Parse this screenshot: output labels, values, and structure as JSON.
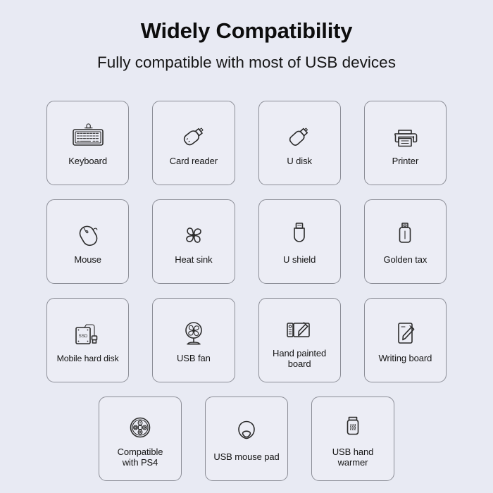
{
  "header": {
    "title": "Widely Compatibility",
    "subtitle": "Fully compatible with most of USB devices"
  },
  "colors": {
    "background": "#e8eaf3",
    "card_background": "#ecedf5",
    "card_border": "#8b8d96",
    "icon_stroke": "#2b2b2b",
    "text": "#151515"
  },
  "grid": {
    "rows": [
      {
        "cards": [
          {
            "label": "Keyboard",
            "icon": "keyboard-icon"
          },
          {
            "label": "Card reader",
            "icon": "card-reader-icon"
          },
          {
            "label": "U disk",
            "icon": "u-disk-icon"
          },
          {
            "label": "Printer",
            "icon": "printer-icon"
          }
        ]
      },
      {
        "cards": [
          {
            "label": "Mouse",
            "icon": "mouse-icon"
          },
          {
            "label": "Heat sink",
            "icon": "heat-sink-fan-icon"
          },
          {
            "label": "U shield",
            "icon": "u-shield-icon"
          },
          {
            "label": "Golden tax",
            "icon": "golden-tax-usb-icon"
          }
        ]
      },
      {
        "cards": [
          {
            "label": "Mobile hard disk",
            "icon": "mobile-hard-disk-icon"
          },
          {
            "label": "USB fan",
            "icon": "usb-fan-icon"
          },
          {
            "label": "Hand painted\nboard",
            "icon": "drawing-tablet-icon"
          },
          {
            "label": "Writing board",
            "icon": "writing-board-icon"
          }
        ]
      },
      {
        "cards": [
          {
            "label": "Compatible\nwith PS4",
            "icon": "gamepad-ps4-icon"
          },
          {
            "label": "USB mouse pad",
            "icon": "mouse-pad-icon"
          },
          {
            "label": "USB hand\nwarmer",
            "icon": "hand-warmer-icon"
          }
        ]
      }
    ]
  }
}
